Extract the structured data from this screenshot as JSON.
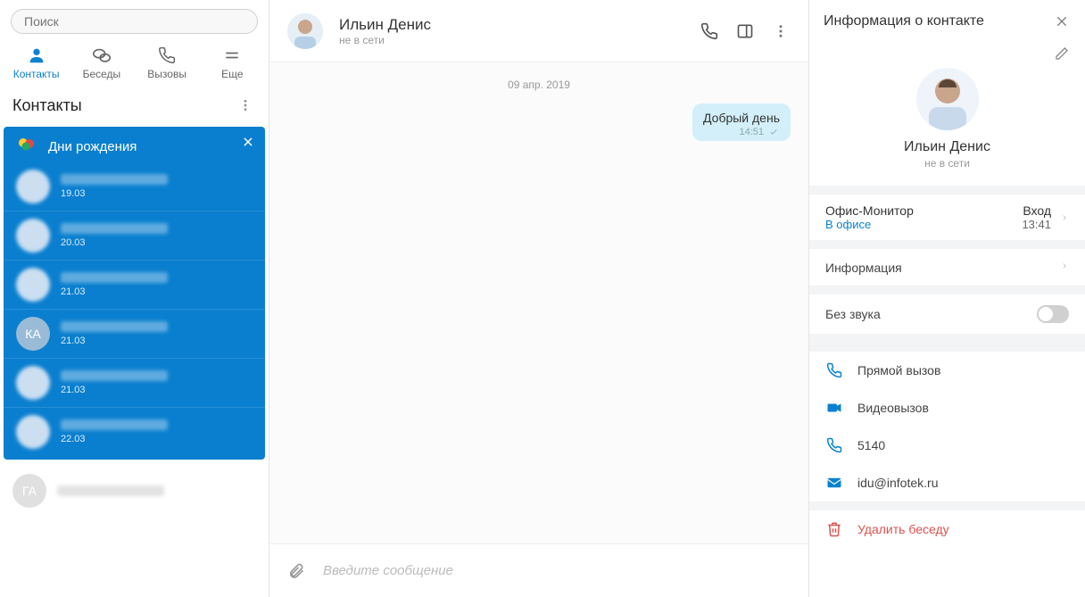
{
  "sidebar": {
    "search_placeholder": "Поиск",
    "tabs": {
      "contacts": "Контакты",
      "chats": "Беседы",
      "calls": "Вызовы",
      "more": "Еще"
    },
    "section_title": "Контакты",
    "birthday": {
      "title": "Дни рождения",
      "items": [
        {
          "avatar_text": "",
          "date": "19.03"
        },
        {
          "avatar_text": "",
          "date": "20.03"
        },
        {
          "avatar_text": "",
          "date": "21.03"
        },
        {
          "avatar_text": "КА",
          "date": "21.03"
        },
        {
          "avatar_text": "",
          "date": "21.03"
        },
        {
          "avatar_text": "",
          "date": "22.03"
        }
      ]
    },
    "contact_below": {
      "avatar_text": "ГА"
    }
  },
  "chat": {
    "contact_name": "Ильин Денис",
    "contact_status": "не в сети",
    "date_divider": "09 апр. 2019",
    "messages": [
      {
        "text": "Добрый день",
        "time": "14:51"
      }
    ],
    "input_placeholder": "Введите сообщение"
  },
  "info": {
    "panel_title": "Информация о контакте",
    "name": "Ильин Денис",
    "status": "не в сети",
    "office_monitor_label": "Офис-Монитор",
    "office_status": "В офисе",
    "login_label": "Вход",
    "login_time": "13:41",
    "info_row_label": "Информация",
    "mute_label": "Без звука",
    "actions": {
      "direct_call": "Прямой вызов",
      "video_call": "Видеовызов",
      "extension": "5140",
      "email": "idu@infotek.ru",
      "delete_chat": "Удалить беседу"
    }
  }
}
